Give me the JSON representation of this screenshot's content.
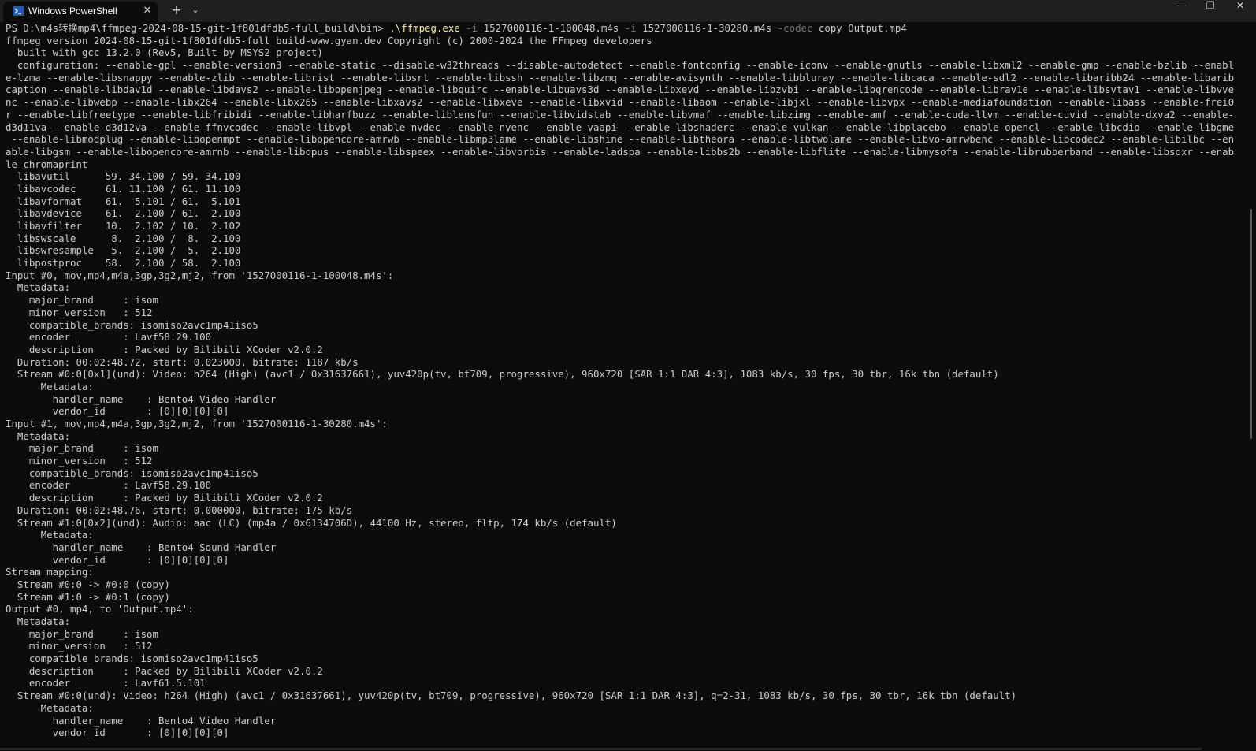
{
  "window": {
    "tab_title": "Windows PowerShell",
    "tab_icon": "powershell-icon",
    "close_tab_glyph": "✕",
    "new_tab_glyph": "+",
    "dropdown_glyph": "⌄",
    "minimize_glyph": "—",
    "restore_glyph": "❐",
    "close_glyph": "✕"
  },
  "command": {
    "prompt": "PS D:\\m4s转换mp4\\ffmpeg-2024-08-15-git-1f801dfdb5-full_build\\bin> ",
    "exe": ".\\ffmpeg.exe",
    "flag1": " -i",
    "arg1": " 1527000116-1-100048.m4s",
    "flag2": " -i",
    "arg2": " 1527000116-1-30280.m4s",
    "flag3": " -codec",
    "arg3": " copy Output.mp4"
  },
  "output_lines": [
    "ffmpeg version 2024-08-15-git-1f801dfdb5-full_build-www.gyan.dev Copyright (c) 2000-2024 the FFmpeg developers",
    "  built with gcc 13.2.0 (Rev5, Built by MSYS2 project)",
    "  configuration: --enable-gpl --enable-version3 --enable-static --disable-w32threads --disable-autodetect --enable-fontconfig --enable-iconv --enable-gnutls --enable-libxml2 --enable-gmp --enable-bzlib --enabl",
    "e-lzma --enable-libsnappy --enable-zlib --enable-librist --enable-libsrt --enable-libssh --enable-libzmq --enable-avisynth --enable-libbluray --enable-libcaca --enable-sdl2 --enable-libaribb24 --enable-libarib",
    "caption --enable-libdav1d --enable-libdavs2 --enable-libopenjpeg --enable-libquirc --enable-libuavs3d --enable-libxevd --enable-libzvbi --enable-libqrencode --enable-librav1e --enable-libsvtav1 --enable-libvve",
    "nc --enable-libwebp --enable-libx264 --enable-libx265 --enable-libxavs2 --enable-libxeve --enable-libxvid --enable-libaom --enable-libjxl --enable-libvpx --enable-mediafoundation --enable-libass --enable-frei0",
    "r --enable-libfreetype --enable-libfribidi --enable-libharfbuzz --enable-liblensfun --enable-libvidstab --enable-libvmaf --enable-libzimg --enable-amf --enable-cuda-llvm --enable-cuvid --enable-dxva2 --enable-",
    "d3d11va --enable-d3d12va --enable-ffnvcodec --enable-libvpl --enable-nvdec --enable-nvenc --enable-vaapi --enable-libshaderc --enable-vulkan --enable-libplacebo --enable-opencl --enable-libcdio --enable-libgme",
    " --enable-libmodplug --enable-libopenmpt --enable-libopencore-amrwb --enable-libmp3lame --enable-libshine --enable-libtheora --enable-libtwolame --enable-libvo-amrwbenc --enable-libcodec2 --enable-libilbc --en",
    "able-libgsm --enable-libopencore-amrnb --enable-libopus --enable-libspeex --enable-libvorbis --enable-ladspa --enable-libbs2b --enable-libflite --enable-libmysofa --enable-librubberband --enable-libsoxr --enab",
    "le-chromaprint",
    "  libavutil      59. 34.100 / 59. 34.100",
    "  libavcodec     61. 11.100 / 61. 11.100",
    "  libavformat    61.  5.101 / 61.  5.101",
    "  libavdevice    61.  2.100 / 61.  2.100",
    "  libavfilter    10.  2.102 / 10.  2.102",
    "  libswscale      8.  2.100 /  8.  2.100",
    "  libswresample   5.  2.100 /  5.  2.100",
    "  libpostproc    58.  2.100 / 58.  2.100",
    "Input #0, mov,mp4,m4a,3gp,3g2,mj2, from '1527000116-1-100048.m4s':",
    "  Metadata:",
    "    major_brand     : isom",
    "    minor_version   : 512",
    "    compatible_brands: isomiso2avc1mp41iso5",
    "    encoder         : Lavf58.29.100",
    "    description     : Packed by Bilibili XCoder v2.0.2",
    "  Duration: 00:02:48.72, start: 0.023000, bitrate: 1187 kb/s",
    "  Stream #0:0[0x1](und): Video: h264 (High) (avc1 / 0x31637661), yuv420p(tv, bt709, progressive), 960x720 [SAR 1:1 DAR 4:3], 1083 kb/s, 30 fps, 30 tbr, 16k tbn (default)",
    "      Metadata:",
    "        handler_name    : Bento4 Video Handler",
    "        vendor_id       : [0][0][0][0]",
    "Input #1, mov,mp4,m4a,3gp,3g2,mj2, from '1527000116-1-30280.m4s':",
    "  Metadata:",
    "    major_brand     : isom",
    "    minor_version   : 512",
    "    compatible_brands: isomiso2avc1mp41iso5",
    "    encoder         : Lavf58.29.100",
    "    description     : Packed by Bilibili XCoder v2.0.2",
    "  Duration: 00:02:48.76, start: 0.000000, bitrate: 175 kb/s",
    "  Stream #1:0[0x2](und): Audio: aac (LC) (mp4a / 0x6134706D), 44100 Hz, stereo, fltp, 174 kb/s (default)",
    "      Metadata:",
    "        handler_name    : Bento4 Sound Handler",
    "        vendor_id       : [0][0][0][0]",
    "Stream mapping:",
    "  Stream #0:0 -> #0:0 (copy)",
    "  Stream #1:0 -> #0:1 (copy)",
    "Output #0, mp4, to 'Output.mp4':",
    "  Metadata:",
    "    major_brand     : isom",
    "    minor_version   : 512",
    "    compatible_brands: isomiso2avc1mp41iso5",
    "    description     : Packed by Bilibili XCoder v2.0.2",
    "    encoder         : Lavf61.5.101",
    "  Stream #0:0(und): Video: h264 (High) (avc1 / 0x31637661), yuv420p(tv, bt709, progressive), 960x720 [SAR 1:1 DAR 4:3], q=2-31, 1083 kb/s, 30 fps, 30 tbr, 16k tbn (default)",
    "      Metadata:",
    "        handler_name    : Bento4 Video Handler",
    "        vendor_id       : [0][0][0][0]"
  ],
  "colors": {
    "background": "#0c0c0c",
    "text": "#cccccc",
    "command_exe": "#f9f1a5",
    "command_flag": "#767676",
    "titlebar": "#1f1f1f"
  }
}
